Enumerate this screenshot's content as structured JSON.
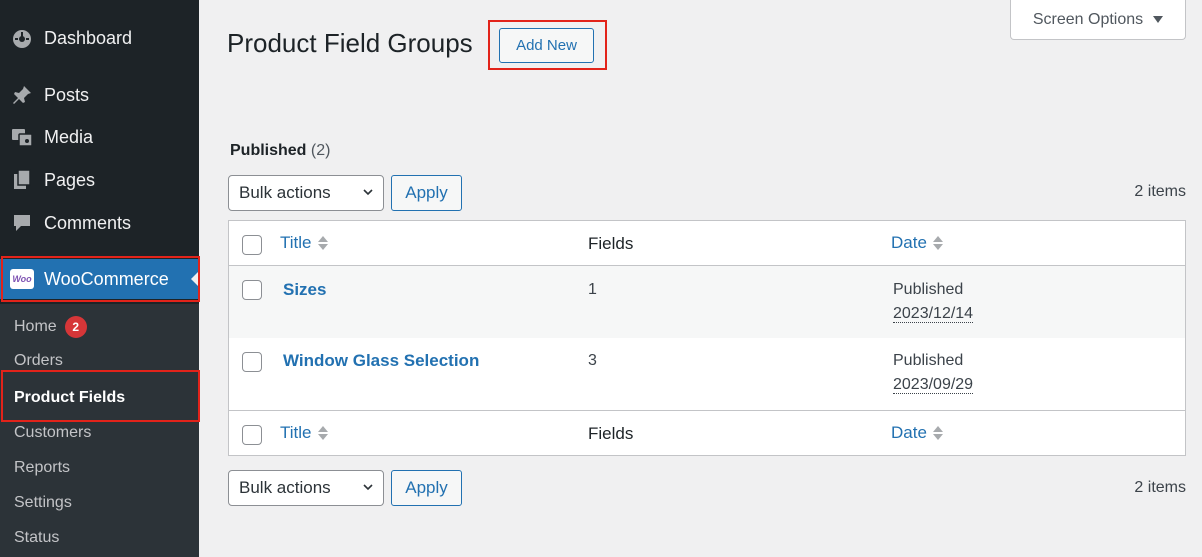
{
  "sidebar": {
    "items": [
      {
        "label": "Dashboard",
        "icon": "dashboard-icon"
      },
      {
        "label": "Posts",
        "icon": "pin-icon"
      },
      {
        "label": "Media",
        "icon": "media-icon"
      },
      {
        "label": "Pages",
        "icon": "pages-icon"
      },
      {
        "label": "Comments",
        "icon": "comment-icon"
      },
      {
        "label": "WooCommerce",
        "icon": "woocommerce-logo-icon"
      }
    ],
    "woo_logo_text": "Woo",
    "submenu": [
      {
        "label": "Home",
        "badge": "2"
      },
      {
        "label": "Orders"
      },
      {
        "label": "Product Fields"
      },
      {
        "label": "Customers"
      },
      {
        "label": "Reports"
      },
      {
        "label": "Settings"
      },
      {
        "label": "Status"
      }
    ]
  },
  "header": {
    "title": "Product Field Groups",
    "add_new_label": "Add New",
    "screen_options_label": "Screen Options"
  },
  "filters": {
    "published_label": "Published",
    "published_count": "(2)"
  },
  "bulk": {
    "select_value": "Bulk actions",
    "apply_label": "Apply",
    "items_count": "2 items"
  },
  "table": {
    "columns": {
      "title": "Title",
      "fields": "Fields",
      "date": "Date"
    },
    "rows": [
      {
        "title": "Sizes",
        "fields": "1",
        "status": "Published",
        "date": "2023/12/14"
      },
      {
        "title": "Window Glass Selection",
        "fields": "3",
        "status": "Published",
        "date": "2023/09/29"
      }
    ]
  },
  "colors": {
    "sidebar_bg": "#1d2327",
    "submenu_bg": "#2c3338",
    "accent": "#2271b1",
    "highlight_box": "#e2231a",
    "badge": "#d63638"
  }
}
